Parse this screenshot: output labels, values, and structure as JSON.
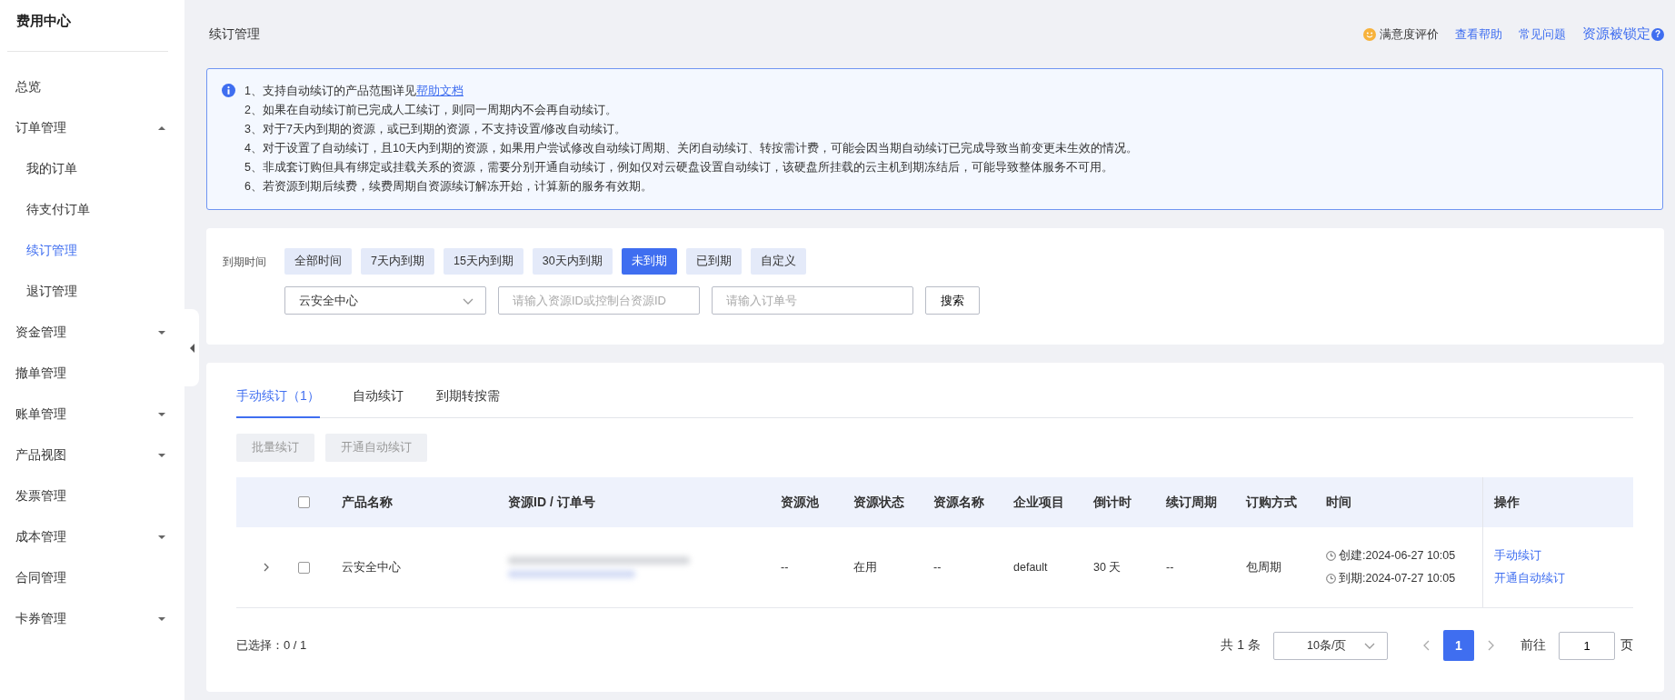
{
  "sidebar": {
    "title": "费用中心",
    "items": [
      {
        "label": "总览",
        "selected": false
      },
      {
        "label": "订单管理",
        "selected": false,
        "expanded": true,
        "children": [
          {
            "label": "我的订单",
            "selected": false
          },
          {
            "label": "待支付订单",
            "selected": false
          },
          {
            "label": "续订管理",
            "selected": true
          },
          {
            "label": "退订管理",
            "selected": false
          }
        ]
      },
      {
        "label": "资金管理",
        "selected": false,
        "expanded": false
      },
      {
        "label": "撤单管理",
        "selected": false
      },
      {
        "label": "账单管理",
        "selected": false,
        "expanded": false
      },
      {
        "label": "产品视图",
        "selected": false,
        "expanded": false
      },
      {
        "label": "发票管理",
        "selected": false
      },
      {
        "label": "成本管理",
        "selected": false,
        "expanded": false
      },
      {
        "label": "合同管理",
        "selected": false
      },
      {
        "label": "卡券管理",
        "selected": false,
        "expanded": false
      }
    ]
  },
  "header": {
    "title": "续订管理",
    "links": [
      {
        "label": "满意度评价",
        "kind": "rating"
      },
      {
        "label": "查看帮助",
        "kind": "link"
      },
      {
        "label": "常见问题",
        "kind": "link"
      },
      {
        "label": "资源被锁定",
        "kind": "help",
        "icon": "?"
      }
    ]
  },
  "notice": {
    "lines": [
      {
        "text": "1、支持自动续订的产品范围详见",
        "link": "帮助文档"
      },
      {
        "text": "2、如果在自动续订前已完成人工续订，则同一周期内不会再自动续订。"
      },
      {
        "text": "3、对于7天内到期的资源，或已到期的资源，不支持设置/修改自动续订。"
      },
      {
        "text": "4、对于设置了自动续订，且10天内到期的资源，如果用户尝试修改自动续订周期、关闭自动续订、转按需计费，可能会因当期自动续订已完成导致当前变更未生效的情况。"
      },
      {
        "text": "5、非成套订购但具有绑定或挂载关系的资源，需要分别开通自动续订，例如仅对云硬盘设置自动续订，该硬盘所挂载的云主机到期冻结后，可能导致整体服务不可用。"
      },
      {
        "text": "6、若资源到期后续费，续费周期自资源续订解冻开始，计算新的服务有效期。"
      }
    ]
  },
  "filter": {
    "label": "到期时间",
    "options": [
      {
        "label": "全部时间",
        "selected": false
      },
      {
        "label": "7天内到期",
        "selected": false
      },
      {
        "label": "15天内到期",
        "selected": false
      },
      {
        "label": "30天内到期",
        "selected": false
      },
      {
        "label": "未到期",
        "selected": true
      },
      {
        "label": "已到期",
        "selected": false
      },
      {
        "label": "自定义",
        "selected": false
      }
    ],
    "product_select": "云安全中心",
    "resource_placeholder": "请输入资源ID或控制台资源ID",
    "order_placeholder": "请输入订单号",
    "search_button": "搜索"
  },
  "tabs": [
    {
      "label": "手动续订（1）",
      "selected": true
    },
    {
      "label": "自动续订",
      "selected": false
    },
    {
      "label": "到期转按需",
      "selected": false
    }
  ],
  "actions": [
    {
      "label": "批量续订",
      "disabled": true
    },
    {
      "label": "开通自动续订",
      "disabled": true
    }
  ],
  "table": {
    "header_checked": false,
    "columns": [
      "产品名称",
      "资源ID / 订单号",
      "资源池",
      "资源状态",
      "资源名称",
      "企业项目",
      "倒计时",
      "续订周期",
      "订购方式",
      "时间",
      "操作"
    ],
    "rows": [
      {
        "expanded": false,
        "checked": false,
        "product": "云安全中心",
        "pool": "--",
        "status": "在用",
        "name": "--",
        "project": "default",
        "countdown": "30 天",
        "cycle": "--",
        "billing": "包周期",
        "created": "创建:2024-06-27 10:05",
        "expires": "到期:2024-07-27 10:05",
        "actions": [
          "手动续订",
          "开通自动续订"
        ]
      }
    ]
  },
  "footer": {
    "selected_count": "已选择：0 / 1",
    "total": "共 1 条",
    "page_size": "10条/页",
    "pages": [
      {
        "label": "1",
        "selected": true
      }
    ],
    "goto_label": "前往",
    "goto_value": "1",
    "goto_suffix": "页"
  }
}
